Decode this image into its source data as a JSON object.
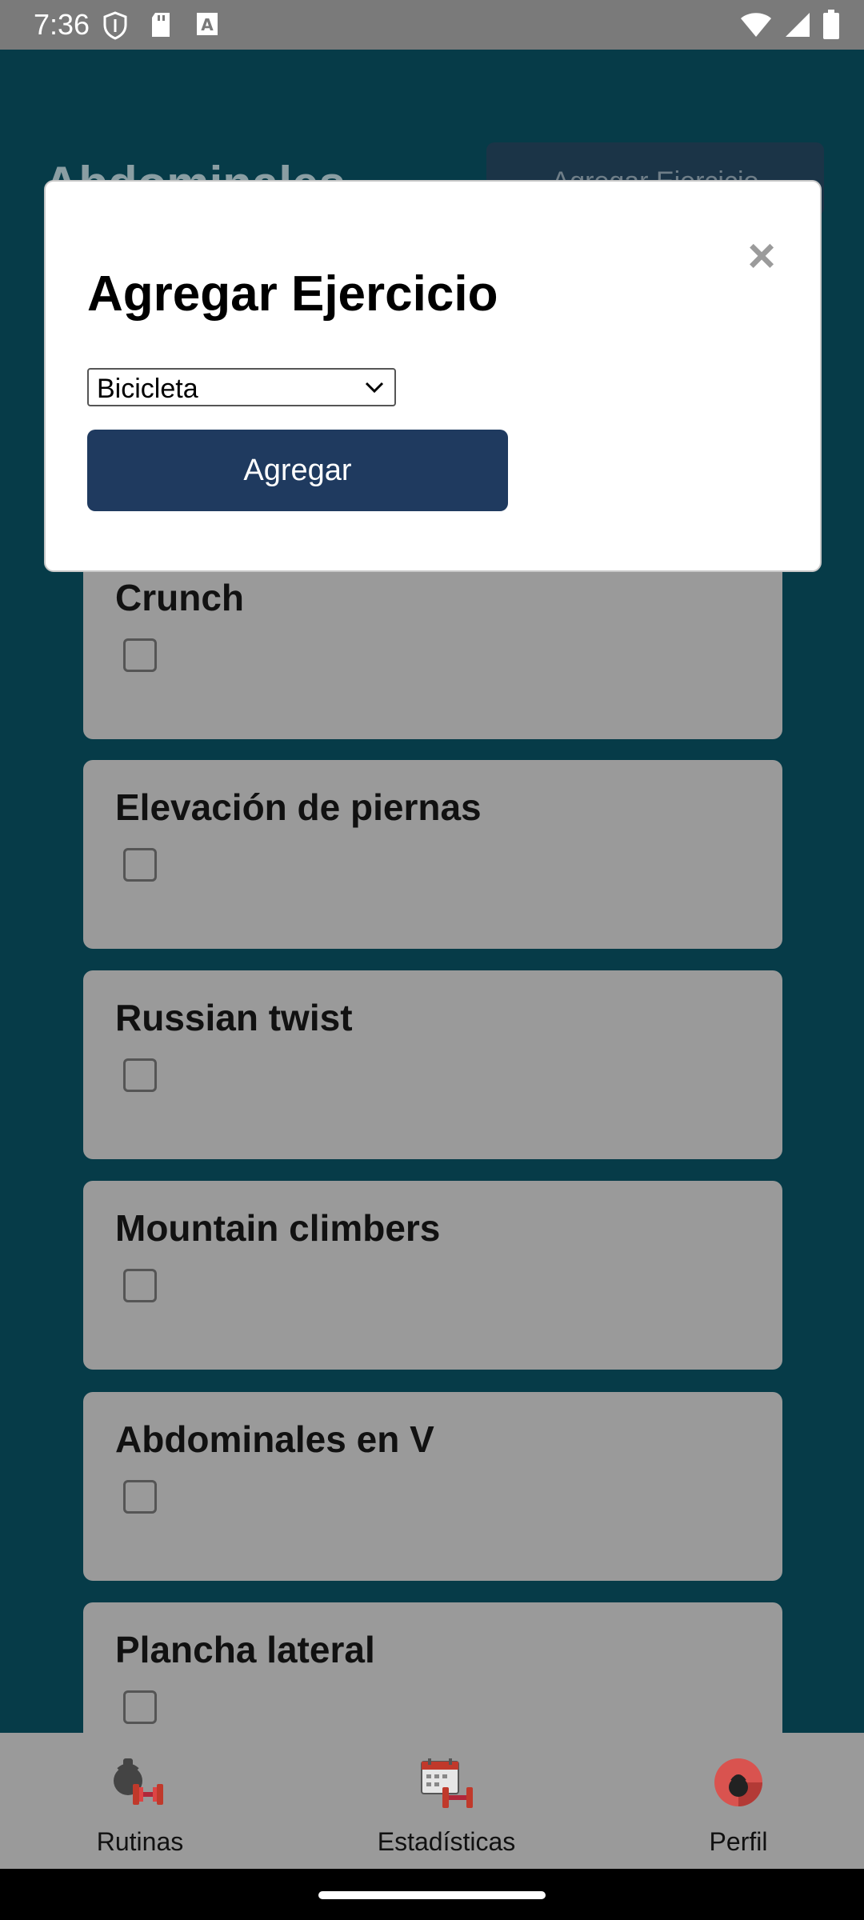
{
  "status_bar": {
    "time": "7:36",
    "icons": [
      "shield-icon",
      "sd-card-icon",
      "a-icon",
      "wifi-icon",
      "signal-icon",
      "battery-icon"
    ]
  },
  "background_page": {
    "title": "Abdominales",
    "add_button_label": "Agregar Ejercicio",
    "exercises": [
      {
        "name": "Crunch",
        "checked": false
      },
      {
        "name": "Elevación de piernas",
        "checked": false
      },
      {
        "name": "Russian twist",
        "checked": false
      },
      {
        "name": "Mountain climbers",
        "checked": false
      },
      {
        "name": "Abdominales en V",
        "checked": false
      },
      {
        "name": "Plancha lateral",
        "checked": false
      }
    ]
  },
  "modal": {
    "title": "Agregar Ejercicio",
    "close_icon": "×",
    "select_value": "Bicicleta",
    "submit_label": "Agregar"
  },
  "bottom_nav": {
    "items": [
      {
        "label": "Rutinas",
        "icon": "kettlebell-dumbbell-icon"
      },
      {
        "label": "Estadísticas",
        "icon": "calendar-dumbbell-icon"
      },
      {
        "label": "Perfil",
        "icon": "profile-kettlebell-icon"
      }
    ]
  },
  "colors": {
    "background": "#063b48",
    "card": "#9a9a9a",
    "primary_button": "#1f3a5f",
    "nav_background": "#9a9a9a",
    "accent_red": "#c0392b"
  }
}
